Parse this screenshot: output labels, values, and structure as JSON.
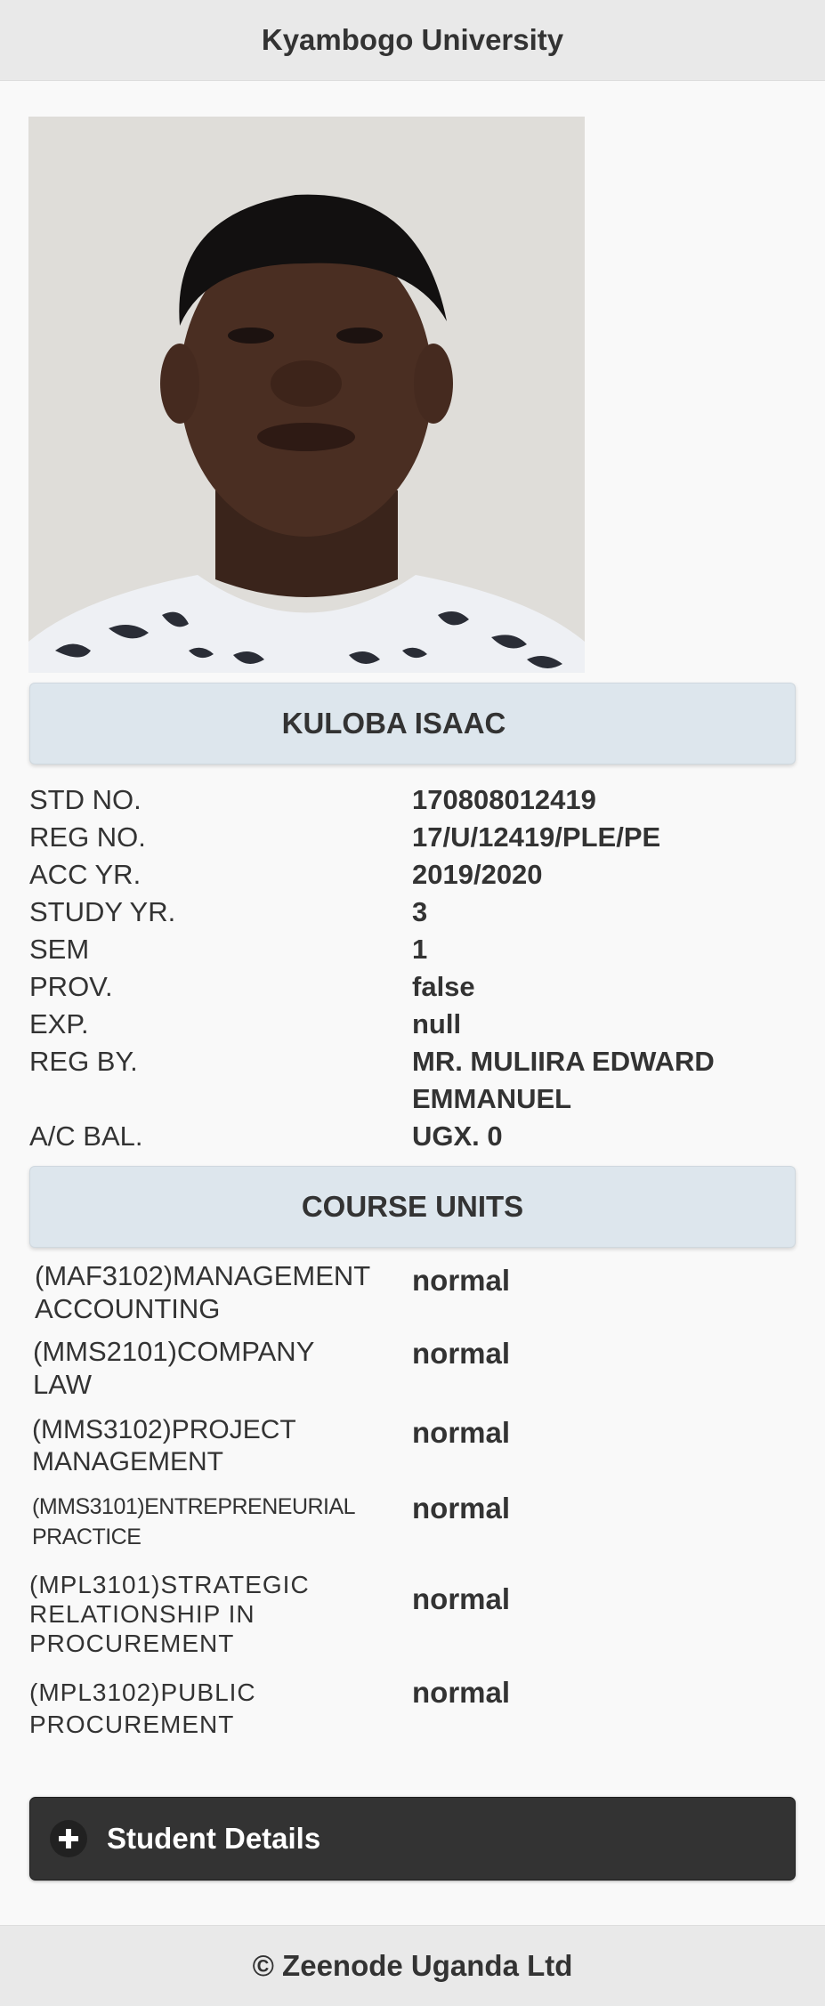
{
  "header": {
    "title": "Kyambogo University"
  },
  "student": {
    "name": "KULOBA ISAAC",
    "fields": [
      {
        "label": "STD NO.",
        "value": "170808012419"
      },
      {
        "label": "REG NO.",
        "value": "17/U/12419/PLE/PE"
      },
      {
        "label": "ACC YR.",
        "value": "2019/2020"
      },
      {
        "label": "STUDY YR.",
        "value": "3"
      },
      {
        "label": "SEM",
        "value": "1"
      },
      {
        "label": "PROV.",
        "value": "false"
      },
      {
        "label": "EXP.",
        "value": "null"
      },
      {
        "label": "REG BY.",
        "value": "MR. MULIIRA EDWARD EMMANUEL"
      },
      {
        "label": "A/C BAL.",
        "value": "UGX. 0"
      }
    ]
  },
  "course_units": {
    "title": "COURSE UNITS",
    "items": [
      {
        "name": "(MAF3102)MANAGEMENT ACCOUNTING",
        "status": "normal"
      },
      {
        "name": "(MMS2101)COMPANY LAW",
        "status": "normal"
      },
      {
        "name": "(MMS3102)PROJECT MANAGEMENT",
        "status": "normal"
      },
      {
        "name": "(MMS3101)ENTREPRENEURIAL PRACTICE",
        "status": "normal"
      },
      {
        "name": "(MPL3101)STRATEGIC RELATIONSHIP IN PROCUREMENT",
        "status": "normal"
      },
      {
        "name": "(MPL3102)PUBLIC PROCUREMENT",
        "status": "normal"
      }
    ]
  },
  "details_button": {
    "label": "Student Details",
    "icon": "plus-icon"
  },
  "footer": {
    "text": "© Zeenode Uganda Ltd"
  }
}
